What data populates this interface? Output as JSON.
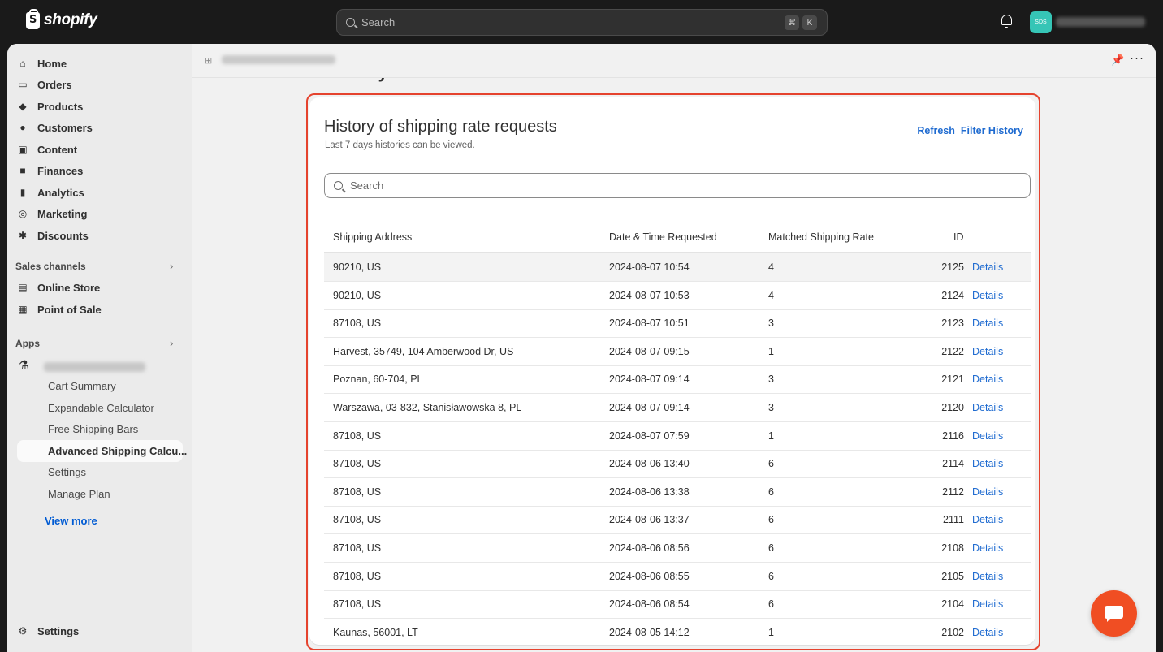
{
  "topbar": {
    "logo_text": "shopify",
    "search_placeholder": "Search",
    "shortcut_keys": [
      "⌘",
      "K"
    ],
    "avatar_initials": "SDS"
  },
  "sidebar": {
    "nav": [
      {
        "label": "Home",
        "icon": "home-icon"
      },
      {
        "label": "Orders",
        "icon": "orders-icon"
      },
      {
        "label": "Products",
        "icon": "products-tag-icon"
      },
      {
        "label": "Customers",
        "icon": "person-icon"
      },
      {
        "label": "Content",
        "icon": "content-icon"
      },
      {
        "label": "Finances",
        "icon": "finances-icon"
      },
      {
        "label": "Analytics",
        "icon": "analytics-bars-icon"
      },
      {
        "label": "Marketing",
        "icon": "marketing-target-icon"
      },
      {
        "label": "Discounts",
        "icon": "discount-badge-icon"
      }
    ],
    "sales_channels_label": "Sales channels",
    "channels": [
      {
        "label": "Online Store",
        "icon": "store-icon"
      },
      {
        "label": "Point of Sale",
        "icon": "pos-icon"
      }
    ],
    "apps_label": "Apps",
    "app_subitems": [
      "Cart Summary",
      "Expandable Calculator",
      "Free Shipping Bars",
      "Advanced Shipping Calcu...",
      "Settings",
      "Manage Plan"
    ],
    "view_more": "View more",
    "settings_label": "Settings"
  },
  "page": {
    "title": "History"
  },
  "card": {
    "title": "History of shipping rate requests",
    "subtitle": "Last 7 days histories can be viewed.",
    "actions": [
      "Refresh",
      "Filter History"
    ],
    "search_placeholder": "Search",
    "columns": [
      "Shipping Address",
      "Date & Time Requested",
      "Matched Shipping Rate",
      "ID"
    ],
    "rows": [
      {
        "address": "90210, US",
        "datetime": "2024-08-07 10:54",
        "rate": "4",
        "id": "2125",
        "action": "Details"
      },
      {
        "address": "90210, US",
        "datetime": "2024-08-07 10:53",
        "rate": "4",
        "id": "2124",
        "action": "Details"
      },
      {
        "address": "87108, US",
        "datetime": "2024-08-07 10:51",
        "rate": "3",
        "id": "2123",
        "action": "Details"
      },
      {
        "address": "Harvest, 35749, 104 Amberwood Dr, US",
        "datetime": "2024-08-07 09:15",
        "rate": "1",
        "id": "2122",
        "action": "Details"
      },
      {
        "address": "Poznan, 60-704, PL",
        "datetime": "2024-08-07 09:14",
        "rate": "3",
        "id": "2121",
        "action": "Details"
      },
      {
        "address": "Warszawa, 03-832, Stanisławowska 8, PL",
        "datetime": "2024-08-07 09:14",
        "rate": "3",
        "id": "2120",
        "action": "Details"
      },
      {
        "address": "87108, US",
        "datetime": "2024-08-07 07:59",
        "rate": "1",
        "id": "2116",
        "action": "Details"
      },
      {
        "address": "87108, US",
        "datetime": "2024-08-06 13:40",
        "rate": "6",
        "id": "2114",
        "action": "Details"
      },
      {
        "address": "87108, US",
        "datetime": "2024-08-06 13:38",
        "rate": "6",
        "id": "2112",
        "action": "Details"
      },
      {
        "address": "87108, US",
        "datetime": "2024-08-06 13:37",
        "rate": "6",
        "id": "2111",
        "action": "Details"
      },
      {
        "address": "87108, US",
        "datetime": "2024-08-06 08:56",
        "rate": "6",
        "id": "2108",
        "action": "Details"
      },
      {
        "address": "87108, US",
        "datetime": "2024-08-06 08:55",
        "rate": "6",
        "id": "2105",
        "action": "Details"
      },
      {
        "address": "87108, US",
        "datetime": "2024-08-06 08:54",
        "rate": "6",
        "id": "2104",
        "action": "Details"
      },
      {
        "address": "Kaunas, 56001, LT",
        "datetime": "2024-08-05 14:12",
        "rate": "1",
        "id": "2102",
        "action": "Details"
      }
    ]
  },
  "colors": {
    "accent_link": "#1f6bd0",
    "highlight_border": "#e5432e",
    "chat_button": "#f04e23",
    "avatar": "#36c5b6"
  }
}
